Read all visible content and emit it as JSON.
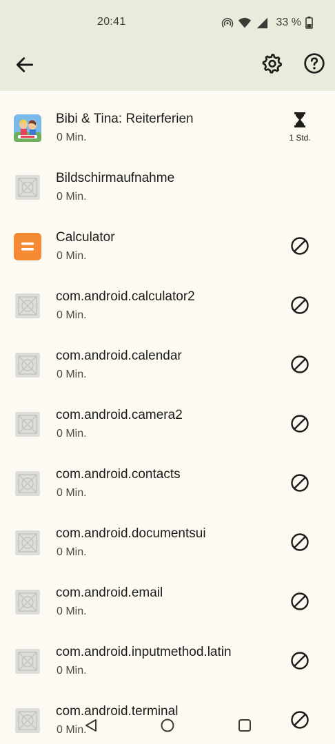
{
  "status_bar": {
    "time": "20:41",
    "battery": "33 %"
  },
  "app_bar": {
    "back_icon": "arrow-left-icon",
    "settings_icon": "gear-icon",
    "help_icon": "question-circle-icon"
  },
  "apps": [
    {
      "name": "Bibi & Tina: Reiterferien",
      "usage": "0 Min.",
      "icon": "bibi-tina-game-icon",
      "limit": "1 Std."
    },
    {
      "name": "Bildschirmaufnahme",
      "usage": "0 Min.",
      "icon": "placeholder-app-icon"
    },
    {
      "name": "Calculator",
      "usage": "0 Min.",
      "icon": "calculator-app-icon"
    },
    {
      "name": "com.android.calculator2",
      "usage": "0 Min.",
      "icon": "placeholder-app-icon"
    },
    {
      "name": "com.android.calendar",
      "usage": "0 Min.",
      "icon": "placeholder-app-icon"
    },
    {
      "name": "com.android.camera2",
      "usage": "0 Min.",
      "icon": "placeholder-app-icon"
    },
    {
      "name": "com.android.contacts",
      "usage": "0 Min.",
      "icon": "placeholder-app-icon"
    },
    {
      "name": "com.android.documentsui",
      "usage": "0 Min.",
      "icon": "placeholder-app-icon"
    },
    {
      "name": "com.android.email",
      "usage": "0 Min.",
      "icon": "placeholder-app-icon"
    },
    {
      "name": "com.android.inputmethod.latin",
      "usage": "0 Min.",
      "icon": "placeholder-app-icon"
    },
    {
      "name": "com.android.terminal",
      "usage": "0 Min.",
      "icon": "placeholder-app-icon"
    }
  ],
  "colors": {
    "header_bg": "#e9ecdc",
    "page_bg": "#fcfaf2",
    "calculator_orange": "#f58a35"
  }
}
